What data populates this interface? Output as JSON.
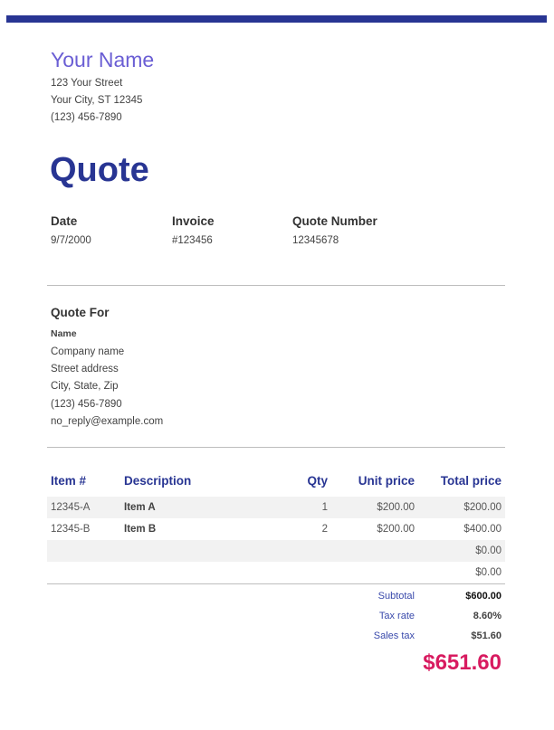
{
  "colors": {
    "accent_bar": "#283593",
    "name_color": "#6a5ed4",
    "title_color": "#283593",
    "table_header": "#283593",
    "row_shade": "#f2f2f2",
    "total_color": "#d81b60"
  },
  "sender": {
    "name": "Your Name",
    "street": "123 Your Street",
    "city": "Your City, ST 12345",
    "phone": "(123) 456-7890"
  },
  "title": "Quote",
  "meta": {
    "date_label": "Date",
    "date_value": "9/7/2000",
    "invoice_label": "Invoice",
    "invoice_value": "#123456",
    "quote_number_label": "Quote Number",
    "quote_number_value": "12345678"
  },
  "quote_for": {
    "title": "Quote For",
    "name": "Name",
    "company": "Company name",
    "street": "Street address",
    "city": "City, State, Zip",
    "phone": "(123) 456-7890",
    "email": "no_reply@example.com"
  },
  "table": {
    "headers": {
      "item": "Item #",
      "description": "Description",
      "qty": "Qty",
      "unit_price": "Unit price",
      "total_price": "Total price"
    },
    "rows": [
      {
        "item": "12345-A",
        "description": "Item A",
        "qty": "1",
        "unit_price": "$200.00",
        "total_price": "$200.00"
      },
      {
        "item": "12345-B",
        "description": "Item B",
        "qty": "2",
        "unit_price": "$200.00",
        "total_price": "$400.00"
      },
      {
        "item": "",
        "description": "",
        "qty": "",
        "unit_price": "",
        "total_price": "$0.00"
      },
      {
        "item": "",
        "description": "",
        "qty": "",
        "unit_price": "",
        "total_price": "$0.00"
      }
    ]
  },
  "summary": {
    "subtotal_label": "Subtotal",
    "subtotal_value": "$600.00",
    "tax_rate_label": "Tax rate",
    "tax_rate_value": "8.60%",
    "sales_tax_label": "Sales tax",
    "sales_tax_value": "$51.60",
    "total": "$651.60"
  }
}
